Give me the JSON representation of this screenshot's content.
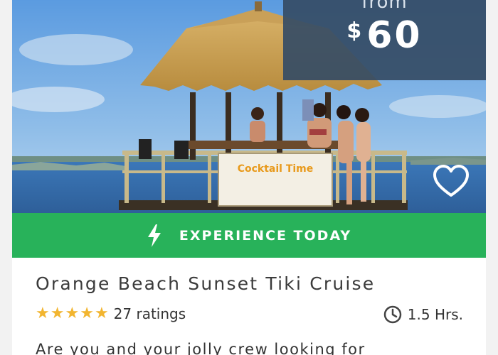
{
  "price": {
    "from_label": "from",
    "currency": "$",
    "amount": "60"
  },
  "hero": {
    "sign_text": "Cocktail Time",
    "favorite_icon": "heart-icon"
  },
  "banner": {
    "icon": "lightning-icon",
    "label": "EXPERIENCE TODAY",
    "color": "#28b25a"
  },
  "tour": {
    "title": "Orange Beach Sunset Tiki Cruise",
    "rating_stars": 5,
    "ratings_label": "27 ratings",
    "duration_icon": "clock-icon",
    "duration_label": "1.5 Hrs.",
    "description": "Are you and your jolly crew looking for"
  },
  "colors": {
    "price_box": "#354c65",
    "star": "#f2b530"
  }
}
